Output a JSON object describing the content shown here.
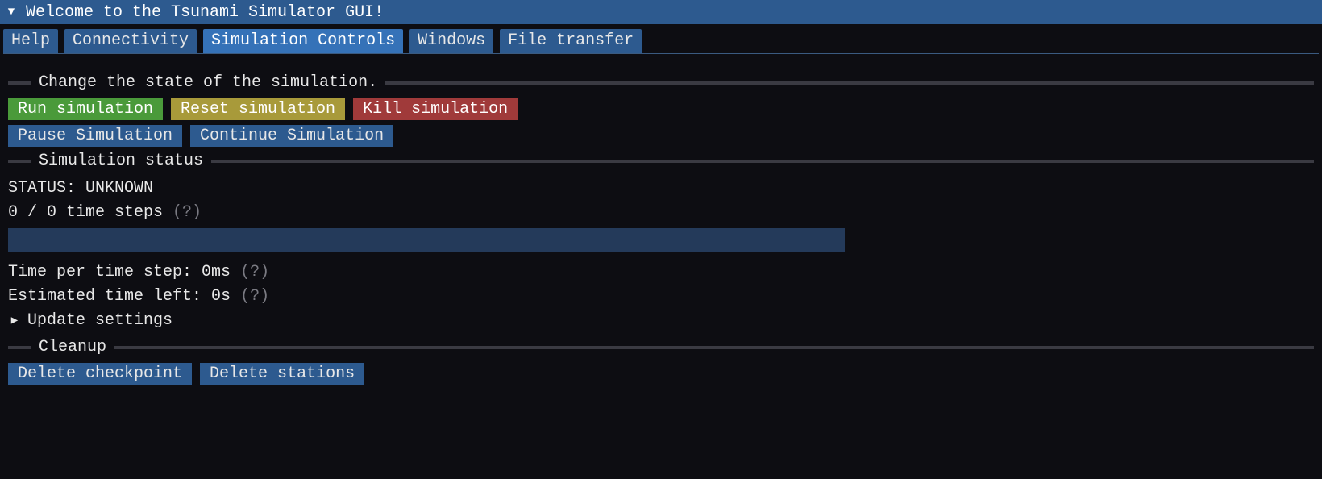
{
  "title": "Welcome to the Tsunami Simulator GUI!",
  "tabs": {
    "help": "Help",
    "connectivity": "Connectivity",
    "sim_controls": "Simulation Controls",
    "windows": "Windows",
    "file_transfer": "File transfer"
  },
  "section_state": {
    "label": "Change the state of the simulation."
  },
  "buttons": {
    "run": "Run simulation",
    "reset": "Reset simulation",
    "kill": "Kill simulation",
    "pause": "Pause Simulation",
    "cont": "Continue Simulation"
  },
  "section_status": {
    "label": "Simulation status"
  },
  "status": {
    "line1": "STATUS: UNKNOWN",
    "steps_current": "0",
    "steps_total": "0",
    "steps_text": "0 / 0 time steps",
    "steps_help": "(?)",
    "time_per_step": "Time per time step: 0ms",
    "time_per_step_help": "(?)",
    "eta": "Estimated time left: 0s",
    "eta_help": "(?)"
  },
  "update_settings_label": "Update settings",
  "section_cleanup": {
    "label": "Cleanup"
  },
  "cleanup": {
    "delete_checkpoint": "Delete checkpoint",
    "delete_stations": "Delete stations"
  },
  "colors": {
    "titlebar": "#2d5a8f",
    "tab_active": "#3572b8",
    "btn_green": "#4a9a3a",
    "btn_yellow": "#a89a3a",
    "btn_red": "#a03a3a",
    "btn_blue": "#2d5a8f",
    "progress_bg": "#243a5a"
  }
}
